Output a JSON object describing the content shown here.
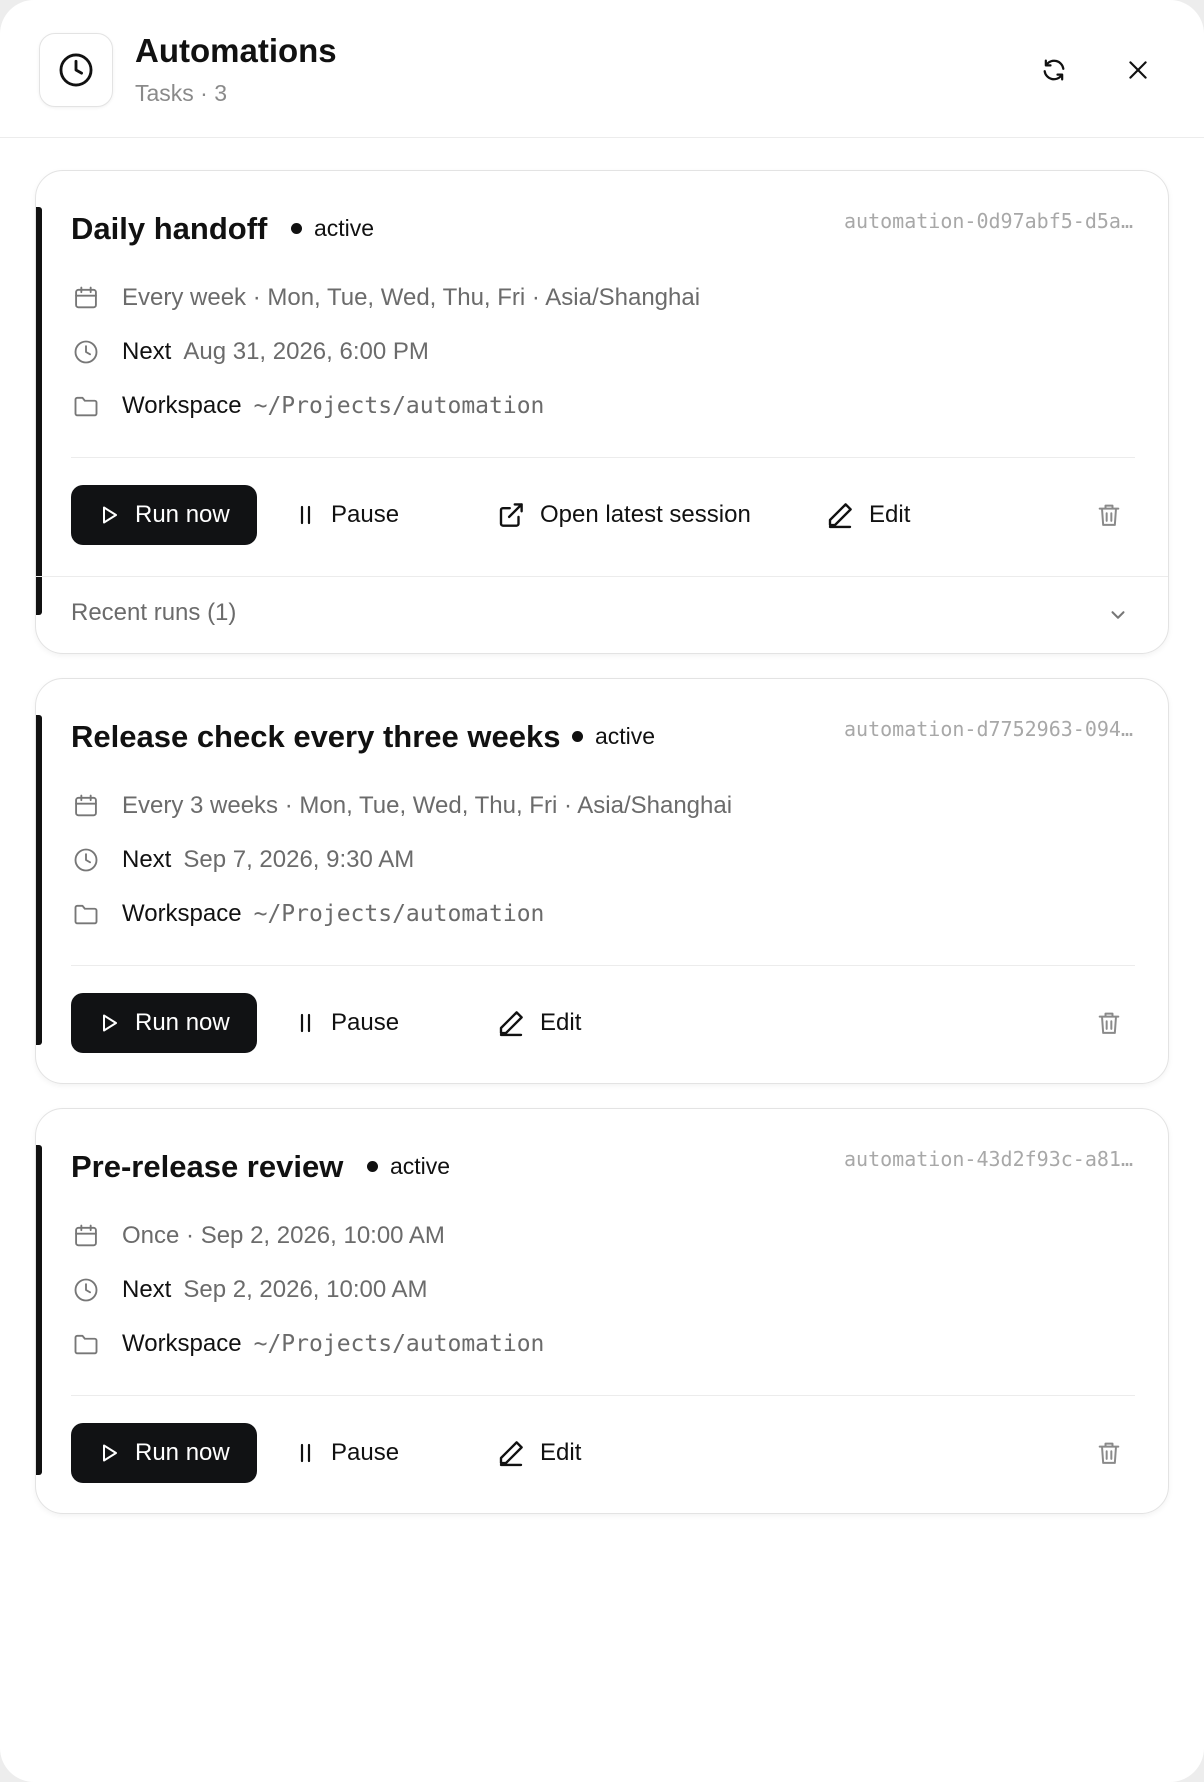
{
  "header": {
    "title": "Automations",
    "subtitle": "Tasks · 3",
    "icons": {
      "app": "clock-icon",
      "refresh": "refresh-icon",
      "close": "close-icon"
    }
  },
  "colors": {
    "primary_button": "#111214",
    "accent_bar": "#111111",
    "muted_text": "#6b6b6b",
    "id_text": "#a8a8a8"
  },
  "tasks": [
    {
      "title": "Daily handoff",
      "status": "active",
      "id": "automation-0d97abf5-d5a…",
      "schedule": "Every week · Mon, Tue, Wed, Thu, Fri · Asia/Shanghai",
      "next_label": "Next",
      "next_value": "Aug 31, 2026, 6:00 PM",
      "workspace_label": "Workspace",
      "workspace_value": "~/Projects/automation",
      "actions": {
        "run": "Run now",
        "pause": "Pause",
        "open_session": "Open latest session",
        "edit": "Edit"
      },
      "recent_runs": "Recent runs (1)"
    },
    {
      "title": "Release check every three weeks",
      "status": "active",
      "id": "automation-d7752963-094…",
      "schedule": "Every 3 weeks · Mon, Tue, Wed, Thu, Fri · Asia/Shanghai",
      "next_label": "Next",
      "next_value": "Sep 7, 2026, 9:30 AM",
      "workspace_label": "Workspace",
      "workspace_value": "~/Projects/automation",
      "actions": {
        "run": "Run now",
        "pause": "Pause",
        "edit": "Edit"
      }
    },
    {
      "title": "Pre-release review",
      "status": "active",
      "id": "automation-43d2f93c-a81…",
      "schedule": "Once · Sep 2, 2026, 10:00 AM",
      "next_label": "Next",
      "next_value": "Sep 2, 2026, 10:00 AM",
      "workspace_label": "Workspace",
      "workspace_value": "~/Projects/automation",
      "actions": {
        "run": "Run now",
        "pause": "Pause",
        "edit": "Edit"
      }
    }
  ]
}
